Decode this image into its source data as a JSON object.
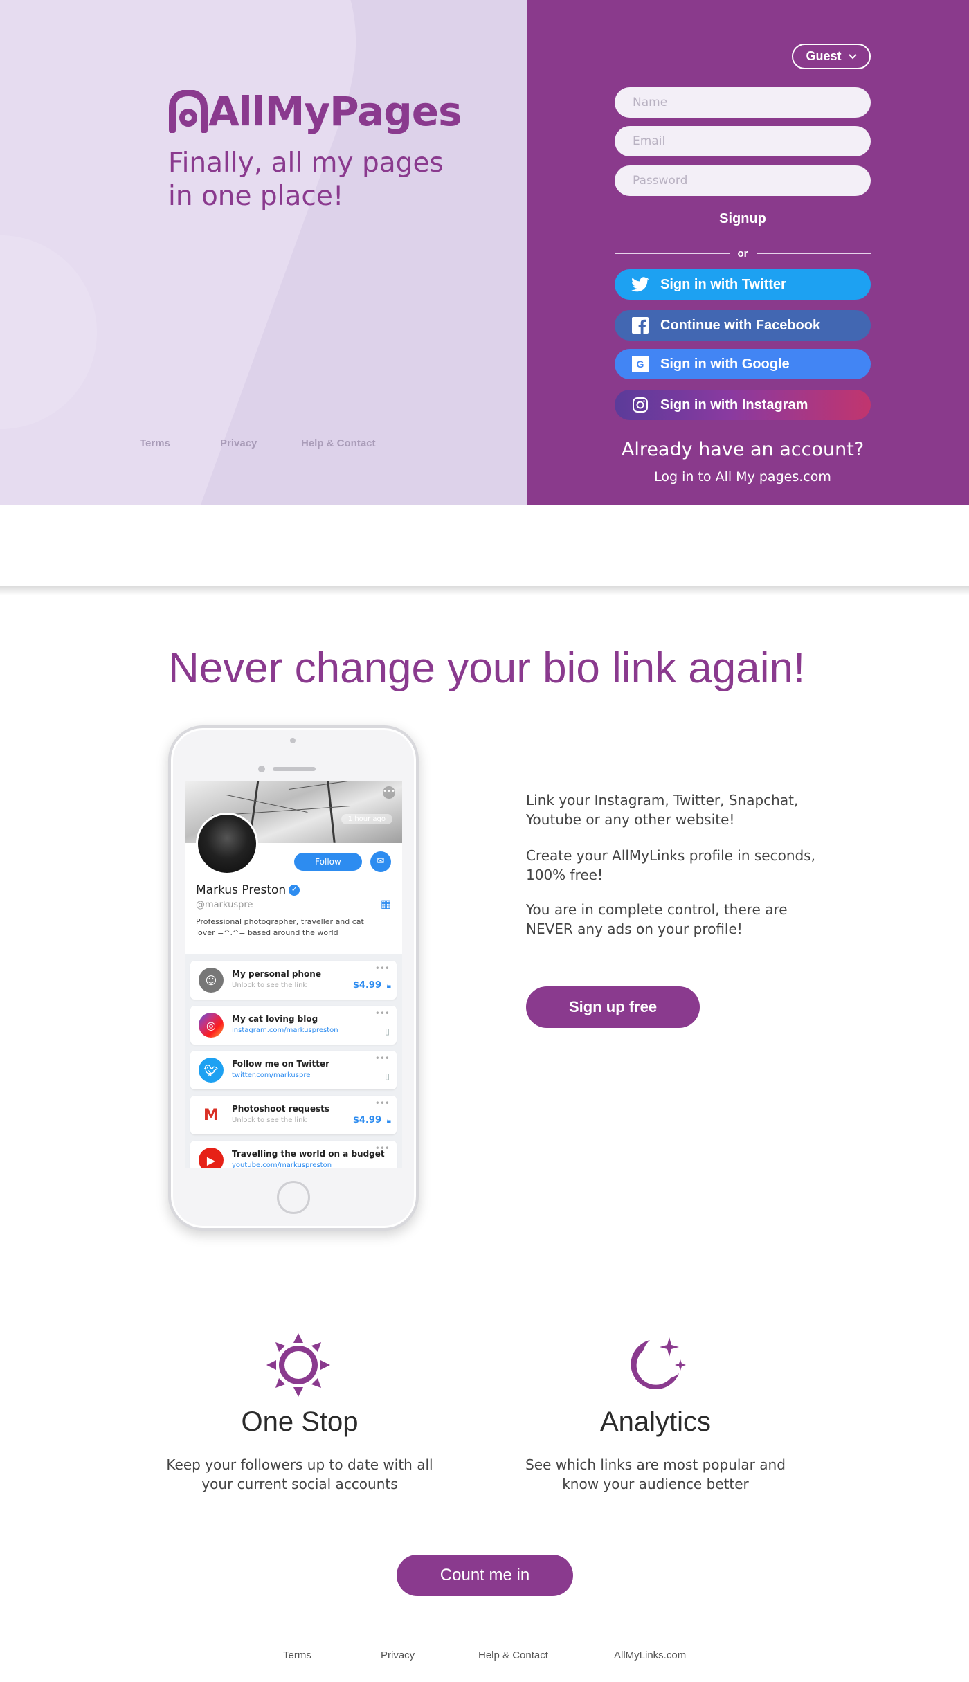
{
  "hero": {
    "brand": "AllMyPages",
    "tagline": "Finally, all my pages in one place!",
    "links": [
      "Terms",
      "Privacy",
      "Help & Contact"
    ]
  },
  "auth": {
    "guest_label": "Guest",
    "name_placeholder": "Name",
    "email_placeholder": "Email",
    "password_placeholder": "Password",
    "signup_label": "Signup",
    "or_label": "or",
    "twitter_label": "Sign in with Twitter",
    "facebook_label": "Continue with Facebook",
    "google_label": "Sign in with Google",
    "instagram_label": "Sign in with Instagram",
    "already_label": "Already have an account?",
    "login_label": "Log in to All My pages.com"
  },
  "main": {
    "headline": "Never change your bio link again!",
    "copy": [
      "Link your Instagram, Twitter, Snapchat, Youtube or any other website!",
      "Create your AllMyLinks profile in seconds, 100% free!",
      "You are in complete control, there are NEVER any ads on your profile!"
    ],
    "signup_free_label": "Sign up free"
  },
  "phone": {
    "time_ago": "1 hour ago",
    "follow_label": "Follow",
    "name": "Markus Preston",
    "handle": "@markuspre",
    "bio": "Professional photographer, traveller and cat lover =^.^= based around the world",
    "items": [
      {
        "title": "My personal phone",
        "sub": "Unlock to see the link",
        "price": "$4.99"
      },
      {
        "title": "My cat loving blog",
        "sub": "instagram.com/markuspreston"
      },
      {
        "title": "Follow me on Twitter",
        "sub": "twitter.com/markuspre"
      },
      {
        "title": "Photoshoot requests",
        "sub": "Unlock to see the link",
        "price": "$4.99"
      },
      {
        "title": "Travelling the world on a budget",
        "sub": "youtube.com/markuspreston"
      }
    ]
  },
  "features": [
    {
      "icon": "sun-icon",
      "title": "One Stop",
      "text": "Keep your followers up to date with all your current social accounts"
    },
    {
      "icon": "moon-stars-icon",
      "title": "Analytics",
      "text": "See which links are most popular and know your audience better"
    }
  ],
  "cta": {
    "count_me_in_label": "Count me in"
  },
  "footer": {
    "links": [
      "Terms",
      "Privacy",
      "Help & Contact",
      "AllMyLinks.com"
    ]
  },
  "colors": {
    "brand_purple": "#8a3a8e",
    "hero_left_bg": "#ddd2ea",
    "hero_right_bg": "#8a3a8c",
    "twitter": "#1da1f2",
    "facebook": "#4267b2",
    "google": "#4285f4"
  }
}
